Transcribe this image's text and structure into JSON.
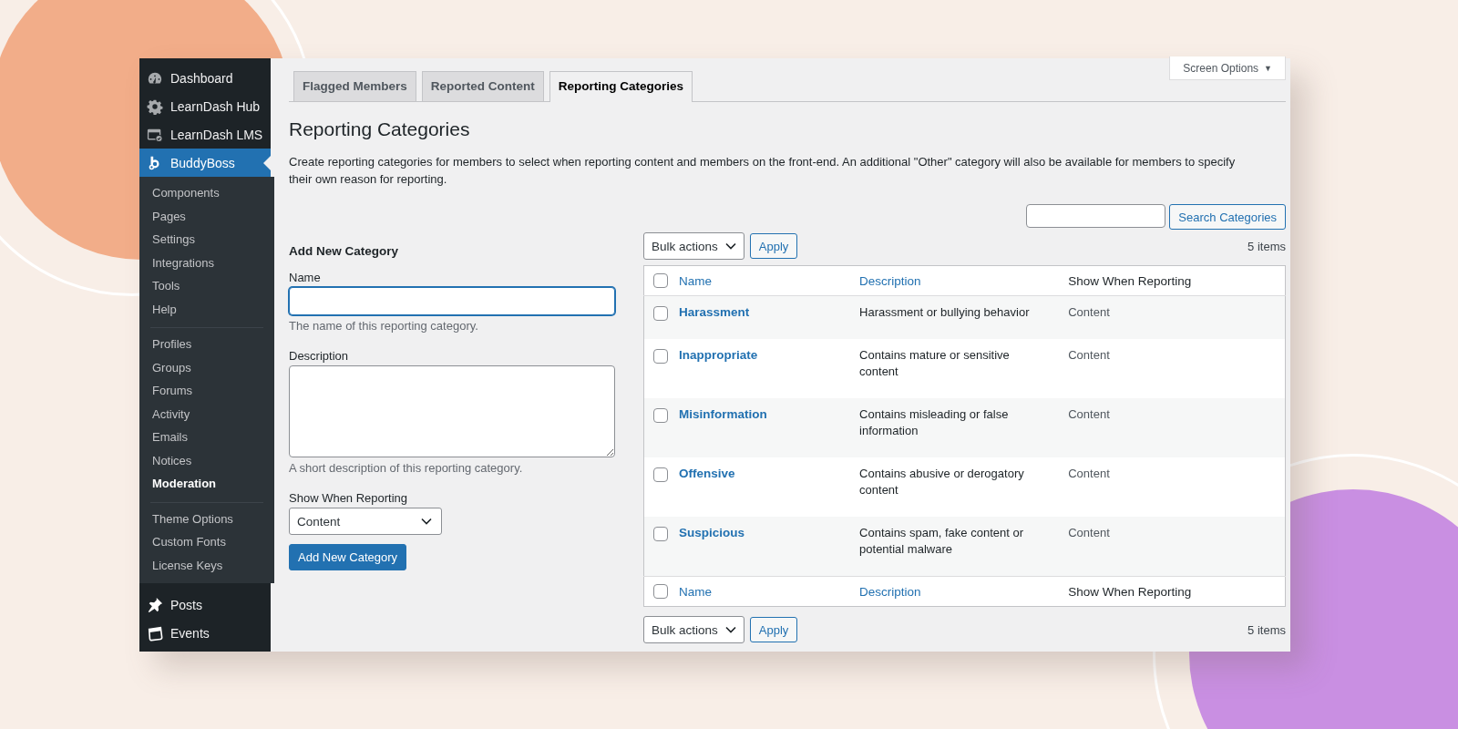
{
  "sidebar": {
    "top_items": [
      {
        "label": "Dashboard",
        "selected": false
      },
      {
        "label": "LearnDash Hub",
        "selected": false
      },
      {
        "label": "LearnDash LMS",
        "selected": false
      },
      {
        "label": "BuddyBoss",
        "selected": true
      }
    ],
    "submenu_groups": [
      [
        {
          "label": "Components",
          "selected": false
        },
        {
          "label": "Pages",
          "selected": false
        },
        {
          "label": "Settings",
          "selected": false
        },
        {
          "label": "Integrations",
          "selected": false
        },
        {
          "label": "Tools",
          "selected": false
        },
        {
          "label": "Help",
          "selected": false
        }
      ],
      [
        {
          "label": "Profiles",
          "selected": false
        },
        {
          "label": "Groups",
          "selected": false
        },
        {
          "label": "Forums",
          "selected": false
        },
        {
          "label": "Activity",
          "selected": false
        },
        {
          "label": "Emails",
          "selected": false
        },
        {
          "label": "Notices",
          "selected": false
        },
        {
          "label": "Moderation",
          "selected": true
        }
      ],
      [
        {
          "label": "Theme Options",
          "selected": false
        },
        {
          "label": "Custom Fonts",
          "selected": false
        },
        {
          "label": "License Keys",
          "selected": false
        }
      ]
    ],
    "bottom_items": [
      {
        "label": "Posts",
        "selected": false
      },
      {
        "label": "Events",
        "selected": false
      }
    ]
  },
  "screen_options": {
    "label": "Screen Options",
    "arrow": "▼"
  },
  "tabs": [
    {
      "label": "Flagged Members",
      "selected": false
    },
    {
      "label": "Reported Content",
      "selected": false
    },
    {
      "label": "Reporting Categories",
      "selected": true
    }
  ],
  "page_title": "Reporting Categories",
  "intro": "Create reporting categories for members to select when reporting content and members on the front-end. An additional \"Other\" category will also be available for members to specify their own reason for reporting.",
  "search": {
    "button": "Search Categories"
  },
  "form": {
    "heading": "Add New Category",
    "name_label": "Name",
    "name_focused": true,
    "name_hint": "The name of this reporting category.",
    "description_label": "Description",
    "description_hint": "A short description of this reporting category.",
    "show_label": "Show When Reporting",
    "show_value": "Content",
    "submit": "Add New Category"
  },
  "bulk_top": {
    "select": "Bulk actions",
    "apply": "Apply",
    "count": "5 items"
  },
  "table": {
    "select_all_checked": false,
    "footer_select_all_checked": false,
    "columns": [
      "Name",
      "Description",
      "Show When Reporting"
    ],
    "rows": [
      {
        "name": "Harassment",
        "description": "Harassment or bullying behavior",
        "show": "Content",
        "checked": false
      },
      {
        "name": "Inappropriate",
        "description": "Contains mature or sensitive content",
        "show": "Content",
        "checked": false
      },
      {
        "name": "Misinformation",
        "description": "Contains misleading or false information",
        "show": "Content",
        "checked": false
      },
      {
        "name": "Offensive",
        "description": "Contains abusive or derogatory content",
        "show": "Content",
        "checked": false
      },
      {
        "name": "Suspicious",
        "description": "Contains spam, fake content or potential malware",
        "show": "Content",
        "checked": false
      }
    ],
    "footer_columns": [
      "Name",
      "Description",
      "Show When Reporting"
    ]
  },
  "bulk_bottom": {
    "select": "Bulk actions",
    "apply": "Apply",
    "count": "5 items"
  }
}
